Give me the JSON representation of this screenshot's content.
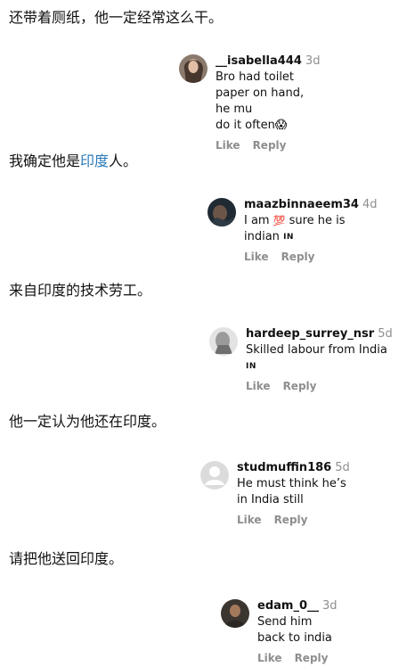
{
  "translations": [
    {
      "pre": "还带着厕纸，他一定经常这么干。",
      "hl": "",
      "post": ""
    },
    {
      "pre": "我确定他是",
      "hl": "印度",
      "post": "人。"
    },
    {
      "pre": "来自印度的技术劳工。",
      "hl": "",
      "post": ""
    },
    {
      "pre": "他一定认为他还在印度。",
      "hl": "",
      "post": ""
    },
    {
      "pre": "请把他送回印度。",
      "hl": "",
      "post": ""
    }
  ],
  "comments": [
    {
      "user": "__isabella444",
      "age": "3d",
      "line1": "Bro had toilet paper on hand, he mu",
      "line2": "do it often",
      "emoji": "😱",
      "like": "Like",
      "reply": "Reply",
      "avatar_icon": "profile-photo-dark-hair"
    },
    {
      "user": "maazbinnaeem34",
      "age": "4d",
      "pre": "I am",
      "emoji": "💯",
      "post": "sure he is indian",
      "flag": "IN",
      "like": "Like",
      "reply": "Reply",
      "avatar_icon": "profile-photo-dark"
    },
    {
      "user": "hardeep_surrey_nsr",
      "age": "5d",
      "text": "Skilled labour from India",
      "flag": "IN",
      "like": "Like",
      "reply": "Reply",
      "avatar_icon": "profile-photo-grey"
    },
    {
      "user": "studmuffin186",
      "age": "5d",
      "text": "He must think he’s in India still",
      "like": "Like",
      "reply": "Reply",
      "avatar_icon": "default-user-icon"
    },
    {
      "user": "edam_0__",
      "age": "3d",
      "text": "Send him back to india",
      "like": "Like",
      "reply": "Reply",
      "avatar_icon": "profile-photo-man"
    }
  ]
}
